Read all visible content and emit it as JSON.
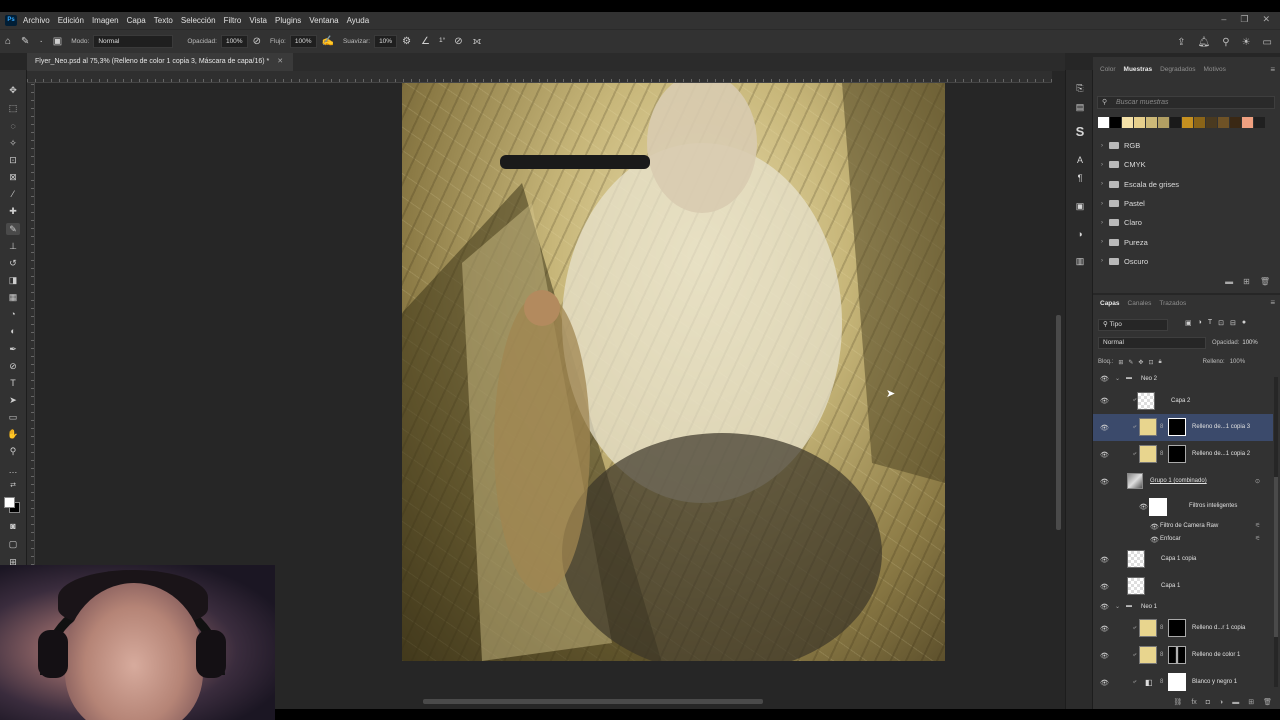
{
  "menubar": {
    "logo": "Ps",
    "items": [
      "Archivo",
      "Edición",
      "Imagen",
      "Capa",
      "Texto",
      "Selección",
      "Filtro",
      "Vista",
      "Plugins",
      "Ventana",
      "Ayuda"
    ]
  },
  "options": {
    "mode_label": "Modo:",
    "mode_value": "Normal",
    "opacity_label": "Opacidad:",
    "opacity_value": "100%",
    "flow_label": "Flujo:",
    "flow_value": "100%",
    "smoothing_label": "Suavizar:",
    "smoothing_value": "10%",
    "angle_value": "1°"
  },
  "document": {
    "tab_title": "Flyer_Neo.psd al 75,3% (Relleno de color 1 copia 3, Máscara de capa/16) *"
  },
  "swatches_panel": {
    "tabs": [
      "Color",
      "Muestras",
      "Degradados",
      "Motivos"
    ],
    "active_tab": "Muestras",
    "search_placeholder": "Buscar muestras",
    "colors": [
      "#ffffff",
      "#000000",
      "#f4e1a8",
      "#e6cf8c",
      "#cdb978",
      "#b29f63",
      "#1a1a1a",
      "#c59020",
      "#8a6418",
      "#4a3a20",
      "#6e5226",
      "#3a2814",
      "#f0a080",
      "#202020"
    ],
    "folders": [
      "RGB",
      "CMYK",
      "Escala de grises",
      "Pastel",
      "Claro",
      "Pureza",
      "Oscuro"
    ]
  },
  "layers_panel": {
    "tabs": [
      "Capas",
      "Canales",
      "Trazados"
    ],
    "active_tab": "Capas",
    "filter_value": "Tipo",
    "blend_mode": "Normal",
    "opacity_label": "Opacidad:",
    "opacity_value": "100%",
    "lock_label": "Bloq.:",
    "fill_label": "Relleno:",
    "fill_value": "100%",
    "layers": [
      {
        "name": "Neo 2",
        "kind": "group"
      },
      {
        "name": "Capa 2",
        "kind": "pixel"
      },
      {
        "name": "Relleno de...1 copia 3",
        "kind": "fill",
        "selected": true
      },
      {
        "name": "Relleno de...1 copia 2",
        "kind": "fill"
      },
      {
        "name": "Grupo 1 (combinado)",
        "kind": "smart"
      },
      {
        "name": "Filtros inteligentes",
        "kind": "filter-mask"
      },
      {
        "name": "Filtro de Camera Raw",
        "kind": "filter"
      },
      {
        "name": "Enfocar",
        "kind": "filter"
      },
      {
        "name": "Capa 1 copia",
        "kind": "pixel"
      },
      {
        "name": "Capa 1",
        "kind": "pixel"
      },
      {
        "name": "Neo 1",
        "kind": "group"
      },
      {
        "name": "Relleno d...r 1 copia",
        "kind": "fill"
      },
      {
        "name": "Relleno de color 1",
        "kind": "fill"
      },
      {
        "name": "Blanco y negro 1",
        "kind": "adjust"
      }
    ]
  }
}
